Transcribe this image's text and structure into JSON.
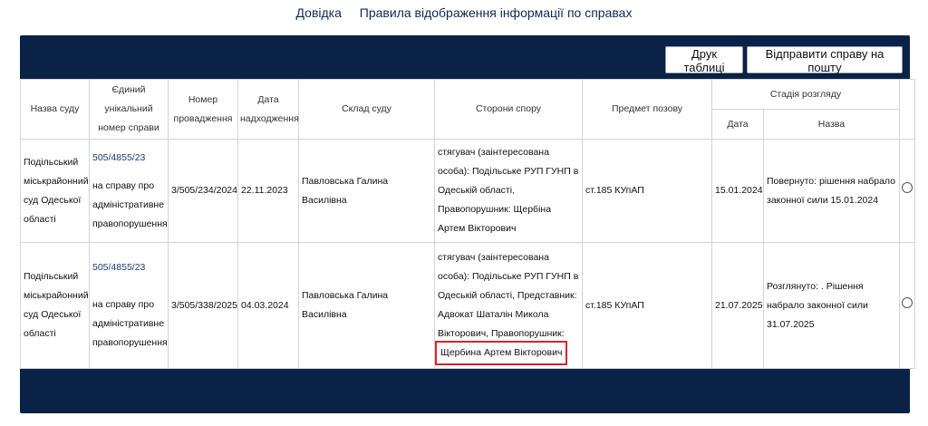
{
  "nav": {
    "help": "Довідка",
    "rules": "Правила відображення інформації по справах"
  },
  "toolbar": {
    "print_label": "Друк таблиці",
    "mail_label": "Відправити справу на пошту"
  },
  "table": {
    "headers": {
      "court": "Назва суду",
      "unique_no": "Єдиний унікальний номер справи",
      "proc_no": "Номер провадження",
      "date_in": "Дата надходження",
      "composition": "Склад суду",
      "parties": "Сторони спору",
      "subject": "Предмет позову",
      "stage": "Стадія розгляду",
      "stage_date": "Дата",
      "stage_name": "Назва"
    },
    "rows": [
      {
        "court": "Подільський міськрайонний суд Одеської області",
        "case_no": "505/4855/23",
        "case_desc": "на справу про адміністративне правопорушення",
        "proc_no": "3/505/234/2024",
        "date_in": "22.11.2023",
        "composition": "Павловська Галина Василівна",
        "parties": "стягувач (заінтересована особа): Подільське РУП ГУНП в Одеській області, Правопорушник: Щербіна Артем Вікторович",
        "subject": "ст.185 КУпАП",
        "stage_date": "15.01.2024",
        "stage_name": "Повернуто: рішення набрало законної сили 15.01.2024"
      },
      {
        "court": "Подільський міськрайонний суд Одеської області",
        "case_no": "505/4855/23",
        "case_desc": "на справу про адміністративне правопорушення",
        "proc_no": "3/505/338/2025",
        "date_in": "04.03.2024",
        "composition": "Павловська Галина Василівна",
        "parties_main": "стягувач (заінтересована особа): Подільське РУП ГУНП в Одеській області, Представник: Адвокат Шаталін Микола Вікторович, Правопорушник:",
        "parties_highlight": "Щербина Артем Вікторович",
        "subject": "ст.185 КУпАП",
        "stage_date": "21.07.2025",
        "stage_name": "Розглянуто: . Рішення набрало законної сили 31.07.2025"
      }
    ]
  },
  "colors": {
    "panel_bg": "#0b2247",
    "link": "#1a3a7a",
    "highlight": "#d9232a"
  }
}
